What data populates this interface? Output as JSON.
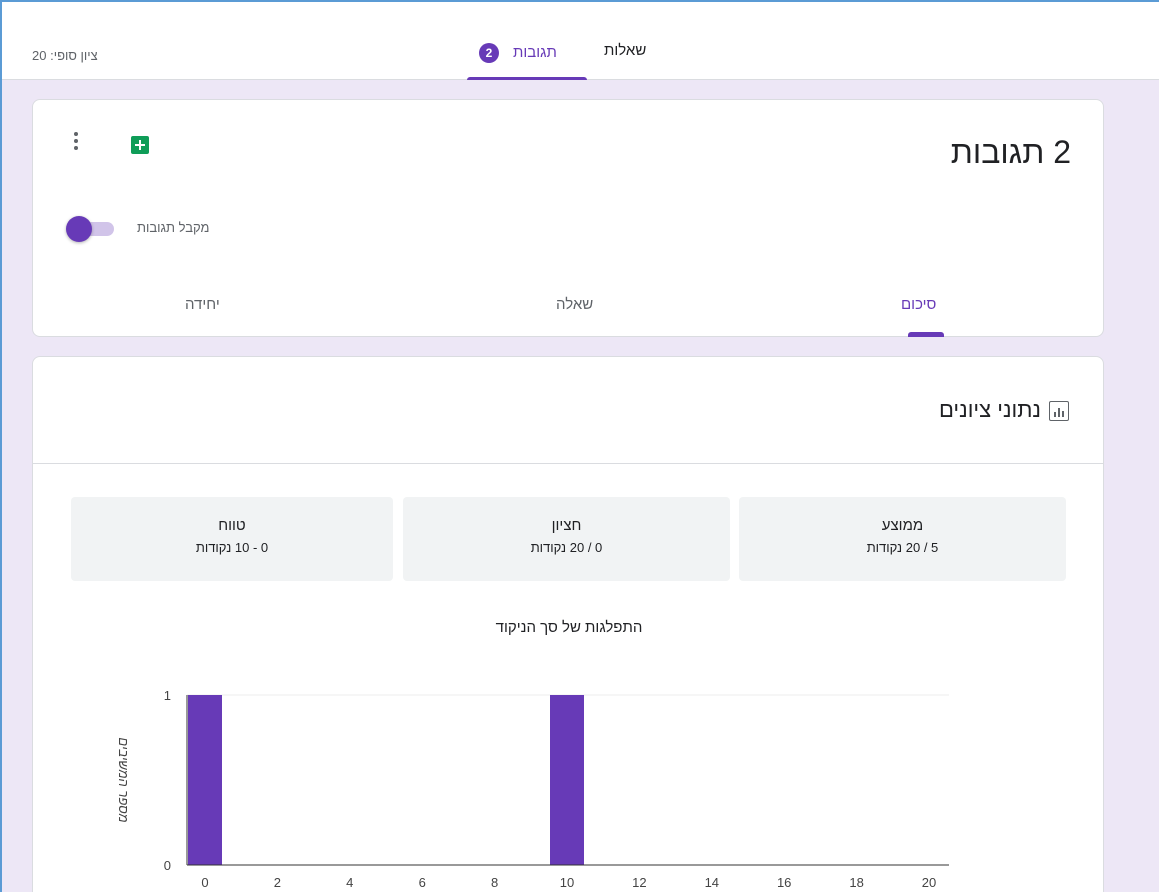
{
  "topbar": {
    "final_score": "ציון סופי: 20",
    "tabs": {
      "questions": "שאלות",
      "responses": "תגובות",
      "responses_count": "2"
    }
  },
  "header_card": {
    "title": "2 תגובות",
    "accepting_label": "מקבל תגובות",
    "accepting": true,
    "subtabs": {
      "summary": "סיכום",
      "question": "שאלה",
      "individual": "יחידה"
    },
    "icons": [
      "more-vert-icon",
      "sheets-icon"
    ]
  },
  "stats_card": {
    "title": "נתוני ציונים",
    "average": {
      "label": "ממוצע",
      "value": "5 / 20 נקודות"
    },
    "median": {
      "label": "חציון",
      "value": "0 / 20 נקודות"
    },
    "range": {
      "label": "טווח",
      "value": "0 - 10 נקודות"
    }
  },
  "colors": {
    "accent": "#673ab7",
    "background": "#ede7f6",
    "sheets_green": "#0f9d58"
  },
  "chart_data": {
    "type": "bar",
    "title": "התפלגות של סך הניקוד",
    "ylabel": "מספר המשיבים",
    "xlabel": "",
    "x_ticks": [
      "0",
      "2",
      "4",
      "6",
      "8",
      "10",
      "12",
      "14",
      "16",
      "18",
      "20"
    ],
    "y_ticks": [
      "0",
      "1"
    ],
    "xlim": [
      0,
      20
    ],
    "ylim": [
      0,
      1
    ],
    "categories": [
      0,
      10
    ],
    "values": [
      1,
      1
    ],
    "bar_color": "#673ab7"
  }
}
